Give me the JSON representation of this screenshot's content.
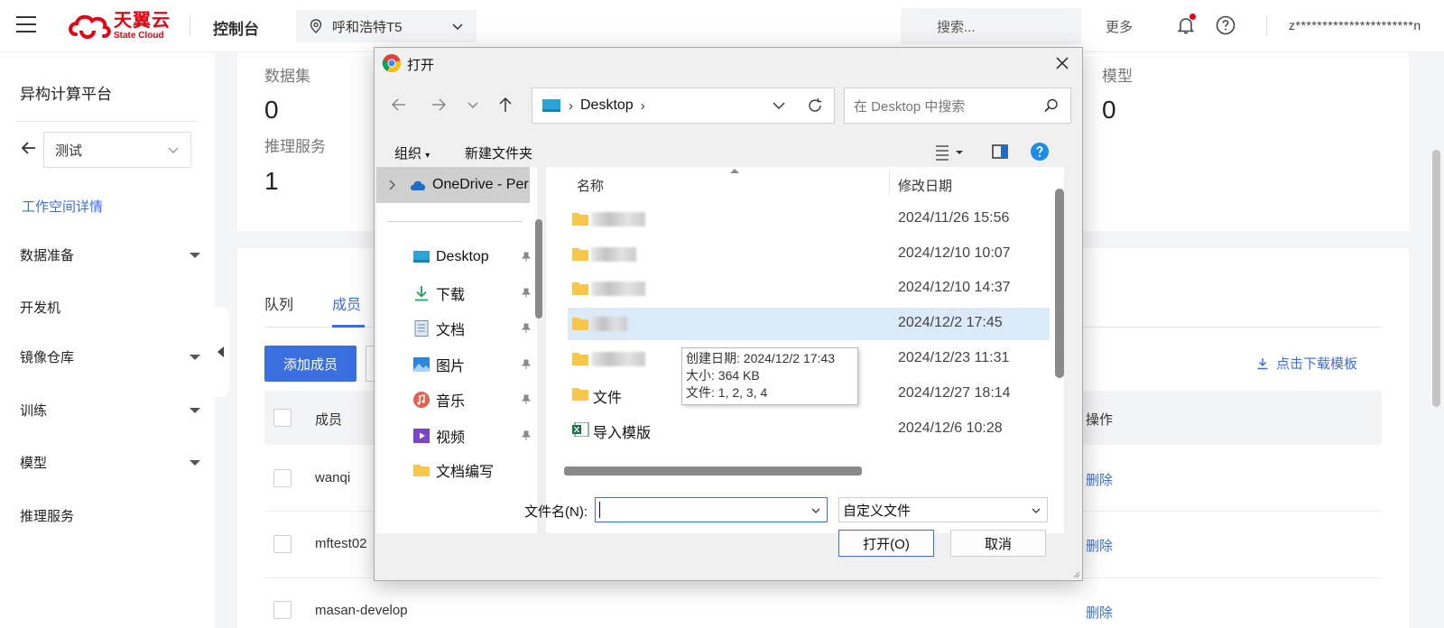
{
  "topbar": {
    "logo_cn": "天翼云",
    "logo_en": "State Cloud",
    "console": "控制台",
    "region": "呼和浩特T5",
    "search_placeholder": "搜索...",
    "more": "更多",
    "user": "z**********************n"
  },
  "sidebar": {
    "title": "异构计算平台",
    "workspace": "测试",
    "link": "工作空间详情",
    "items": [
      {
        "label": "数据准备",
        "expandable": true
      },
      {
        "label": "开发机",
        "expandable": false
      },
      {
        "label": "镜像仓库",
        "expandable": true
      },
      {
        "label": "训练",
        "expandable": true
      },
      {
        "label": "模型",
        "expandable": true
      },
      {
        "label": "推理服务",
        "expandable": false
      }
    ]
  },
  "stats": {
    "dataset_label": "数据集",
    "dataset_value": "0",
    "inference_label": "推理服务",
    "inference_value": "1",
    "model_label": "模型",
    "model_value": "0"
  },
  "main": {
    "tabs": [
      "队列",
      "成员"
    ],
    "active_tab": "成员",
    "add_member": "添加成员",
    "download_template": "点击下载模板",
    "columns": {
      "member": "成员",
      "action": "操作"
    },
    "rows": [
      {
        "member": "wanqi",
        "action": "删除"
      },
      {
        "member": "mftest02",
        "action": "删除"
      },
      {
        "member": "masan-develop",
        "action": "删除"
      }
    ]
  },
  "dialog": {
    "title": "打开",
    "address": "Desktop",
    "search_placeholder": "在 Desktop 中搜索",
    "toolbar": {
      "organize": "组织",
      "new_folder": "新建文件夹"
    },
    "nav": {
      "onedrive": "OneDrive - Per",
      "items": [
        {
          "label": "Desktop",
          "icon": "desktop-icon"
        },
        {
          "label": "下载",
          "icon": "download-icon"
        },
        {
          "label": "文档",
          "icon": "document-icon"
        },
        {
          "label": "图片",
          "icon": "picture-icon"
        },
        {
          "label": "音乐",
          "icon": "music-icon"
        },
        {
          "label": "视频",
          "icon": "video-icon"
        },
        {
          "label": "文档编写",
          "icon": "folder-icon"
        }
      ]
    },
    "columns": {
      "name": "名称",
      "modified": "修改日期"
    },
    "files": [
      {
        "name": "",
        "date": "2024/11/26 15:56",
        "type": "folder"
      },
      {
        "name": "",
        "date": "2024/12/10 10:07",
        "type": "folder"
      },
      {
        "name": "",
        "date": "2024/12/10 14:37",
        "type": "folder"
      },
      {
        "name": "",
        "date": "2024/12/2 17:45",
        "type": "folder"
      },
      {
        "name": "",
        "date": "2024/12/23 11:31",
        "type": "folder"
      },
      {
        "name": "文件",
        "date": "2024/12/27 18:14",
        "type": "folder"
      },
      {
        "name": "导入模版",
        "date": "2024/12/6 10:28",
        "type": "excel"
      }
    ],
    "tooltip": {
      "created": "创建日期: 2024/12/2 17:43",
      "size": "大小: 364 KB",
      "files": "文件: 1, 2, 3, 4"
    },
    "filename_label": "文件名(N):",
    "filename_value": "",
    "filetype": "自定义文件",
    "open": "打开(O)",
    "cancel": "取消"
  }
}
